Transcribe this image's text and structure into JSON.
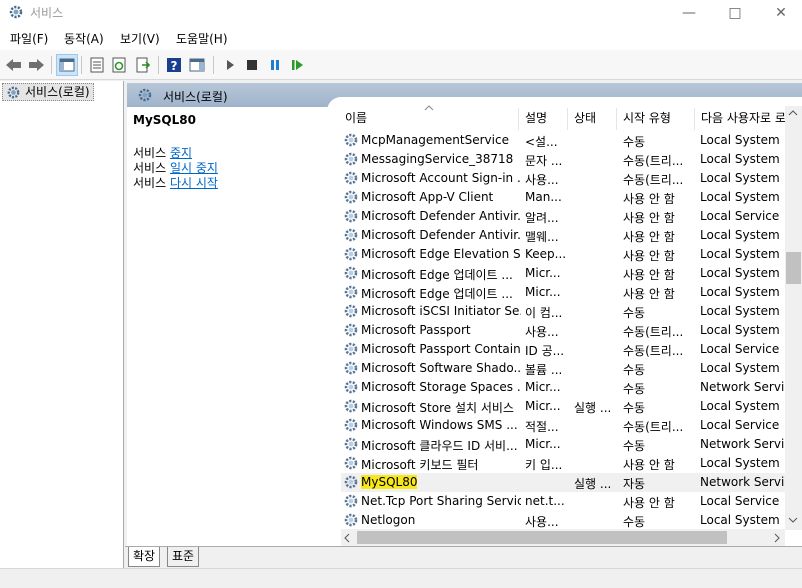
{
  "window": {
    "title": "서비스"
  },
  "menu": [
    "파일(F)",
    "동작(A)",
    "보기(V)",
    "도움말(H)"
  ],
  "tree": {
    "root_label": "서비스(로컬)"
  },
  "panel_header": {
    "label": "서비스(로컬)"
  },
  "detail": {
    "service_name": "MySQL80",
    "actions": [
      {
        "prefix": "서비스 ",
        "link": "중지"
      },
      {
        "prefix": "서비스 ",
        "link": "일시 중지"
      },
      {
        "prefix": "서비스 ",
        "link": "다시 시작"
      }
    ]
  },
  "columns": {
    "name": "이름",
    "desc": "설명",
    "status": "상태",
    "start": "시작 유형",
    "logon": "다음 사용자로 로"
  },
  "rows": [
    {
      "name": "McpManagementService",
      "desc": "<설...",
      "status": "",
      "start": "수동",
      "logon": "Local System"
    },
    {
      "name": "MessagingService_38718",
      "desc": "문자 ...",
      "status": "",
      "start": "수동(트리...",
      "logon": "Local System"
    },
    {
      "name": "Microsoft Account Sign-in ...",
      "desc": "사용...",
      "status": "",
      "start": "수동(트리...",
      "logon": "Local System"
    },
    {
      "name": "Microsoft App-V Client",
      "desc": "Man...",
      "status": "",
      "start": "사용 안 함",
      "logon": "Local System"
    },
    {
      "name": "Microsoft Defender Antivir...",
      "desc": "알려...",
      "status": "",
      "start": "사용 안 함",
      "logon": "Local Service"
    },
    {
      "name": "Microsoft Defender Antivir...",
      "desc": "맬웨...",
      "status": "",
      "start": "사용 안 함",
      "logon": "Local System"
    },
    {
      "name": "Microsoft Edge Elevation S...",
      "desc": "Keep...",
      "status": "",
      "start": "사용 안 함",
      "logon": "Local System"
    },
    {
      "name": "Microsoft Edge 업데이트 ...",
      "desc": "Micr...",
      "status": "",
      "start": "사용 안 함",
      "logon": "Local System"
    },
    {
      "name": "Microsoft Edge 업데이트 ...",
      "desc": "Micr...",
      "status": "",
      "start": "사용 안 함",
      "logon": "Local System"
    },
    {
      "name": "Microsoft iSCSI Initiator Se...",
      "desc": "이 컴...",
      "status": "",
      "start": "수동",
      "logon": "Local System"
    },
    {
      "name": "Microsoft Passport",
      "desc": "사용...",
      "status": "",
      "start": "수동(트리...",
      "logon": "Local System"
    },
    {
      "name": "Microsoft Passport Container",
      "desc": "ID 공...",
      "status": "",
      "start": "수동(트리...",
      "logon": "Local Service"
    },
    {
      "name": "Microsoft Software Shado...",
      "desc": "볼륨 ...",
      "status": "",
      "start": "수동",
      "logon": "Local System"
    },
    {
      "name": "Microsoft Storage Spaces ...",
      "desc": "Micr...",
      "status": "",
      "start": "수동",
      "logon": "Network Service"
    },
    {
      "name": "Microsoft Store 설치 서비스",
      "desc": "Micr...",
      "status": "실행 ...",
      "start": "수동",
      "logon": "Local System"
    },
    {
      "name": "Microsoft Windows SMS ...",
      "desc": "적절...",
      "status": "",
      "start": "수동(트리...",
      "logon": "Local Service"
    },
    {
      "name": "Microsoft 클라우드 ID 서비...",
      "desc": "Micr...",
      "status": "",
      "start": "수동",
      "logon": "Network Service"
    },
    {
      "name": "Microsoft 키보드 필터",
      "desc": "키 입...",
      "status": "",
      "start": "사용 안 함",
      "logon": "Local System"
    },
    {
      "name": "MySQL80",
      "desc": "",
      "status": "실행 ...",
      "start": "자동",
      "logon": "Network Service",
      "selected": true
    },
    {
      "name": "Net.Tcp Port Sharing Service",
      "desc": "net.t...",
      "status": "",
      "start": "사용 안 함",
      "logon": "Local Service"
    },
    {
      "name": "Netlogon",
      "desc": "사용...",
      "status": "",
      "start": "수동",
      "logon": "Local System"
    }
  ],
  "tabs": [
    "확장",
    "표준"
  ],
  "colors": {
    "header_bar": "#a9bccf",
    "link": "#0066cc",
    "highlight": "#f8e71c"
  }
}
